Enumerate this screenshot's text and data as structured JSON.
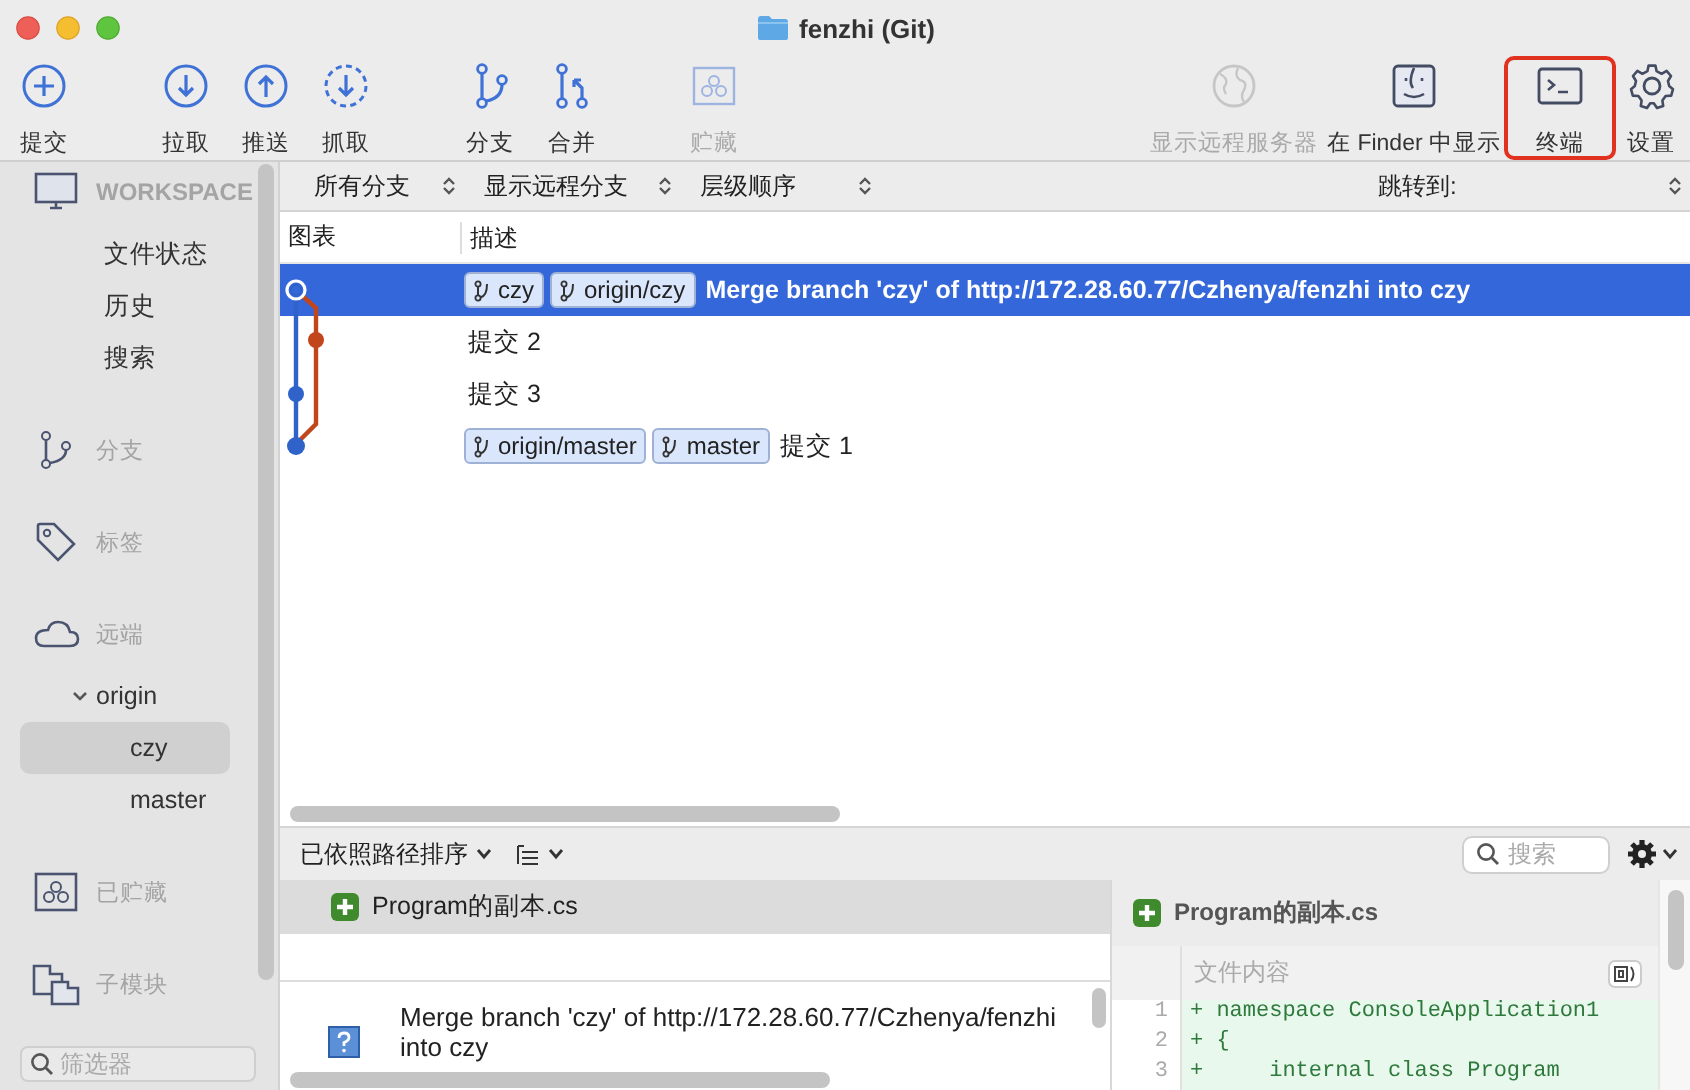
{
  "window": {
    "title": "fenzhi (Git)"
  },
  "toolbar": {
    "buttons": [
      {
        "label": "提交",
        "disabled": false,
        "highlighted": false
      },
      {
        "label": "拉取",
        "disabled": false,
        "highlighted": false
      },
      {
        "label": "推送",
        "disabled": false,
        "highlighted": false
      },
      {
        "label": "抓取",
        "disabled": false,
        "highlighted": false
      },
      {
        "label": "分支",
        "disabled": false,
        "highlighted": false
      },
      {
        "label": "合并",
        "disabled": false,
        "highlighted": false
      },
      {
        "label": "贮藏",
        "disabled": true,
        "highlighted": false
      },
      {
        "label": "显示远程服务器",
        "disabled": true,
        "highlighted": false
      },
      {
        "label": "在 Finder 中显示",
        "disabled": false,
        "highlighted": false
      },
      {
        "label": "终端",
        "disabled": false,
        "highlighted": true
      },
      {
        "label": "设置",
        "disabled": false,
        "highlighted": false
      }
    ]
  },
  "sidebar": {
    "sections": [
      {
        "title": "WORKSPACE",
        "items": [
          {
            "label": "文件状态",
            "selected": false
          },
          {
            "label": "历史",
            "selected": false
          },
          {
            "label": "搜索",
            "selected": false
          }
        ]
      },
      {
        "title": "分支"
      },
      {
        "title": "标签"
      },
      {
        "title": "远端",
        "items": [
          {
            "label": "origin",
            "selected": false,
            "expanded": true,
            "children": [
              {
                "label": "czy",
                "selected": true
              },
              {
                "label": "master",
                "selected": false
              }
            ]
          }
        ]
      },
      {
        "title": "已贮藏"
      },
      {
        "title": "子模块"
      }
    ],
    "filter": {
      "placeholder": "筛选器"
    }
  },
  "history": {
    "filters": [
      {
        "label": "所有分支"
      },
      {
        "label": "显示远程分支"
      },
      {
        "label": "层级顺序"
      }
    ],
    "jump_to": {
      "label": "跳转到:"
    },
    "columns": [
      "图表",
      "描述"
    ],
    "rows": [
      {
        "selected": true,
        "refs": [
          "czy",
          "origin/czy"
        ],
        "message": "Merge branch 'czy' of http://172.28.60.77/Czhenya/fenzhi into czy"
      },
      {
        "selected": false,
        "refs": [],
        "message": "提交 2"
      },
      {
        "selected": false,
        "refs": [],
        "message": "提交 3"
      },
      {
        "selected": false,
        "refs": [
          "origin/master",
          "master"
        ],
        "message": "提交 1"
      }
    ]
  },
  "details": {
    "sort": {
      "label": "已依照路径排序"
    },
    "search": {
      "placeholder": "搜索"
    },
    "files": [
      {
        "name": "Program的副本.cs",
        "kind": "added",
        "selected": true
      }
    ],
    "commit": {
      "message": "Merge branch 'czy' of http://172.28.60.77/Czhenya/fenzhi into czy"
    },
    "diff": {
      "file": "Program的副本.cs",
      "kind": "added",
      "header": "文件内容",
      "lines": [
        {
          "number": "1",
          "sign": "+",
          "text": "namespace ConsoleApplication1"
        },
        {
          "number": "2",
          "sign": "+",
          "text": "{"
        },
        {
          "number": "3",
          "sign": "+",
          "text": "    internal class Program"
        }
      ]
    }
  }
}
